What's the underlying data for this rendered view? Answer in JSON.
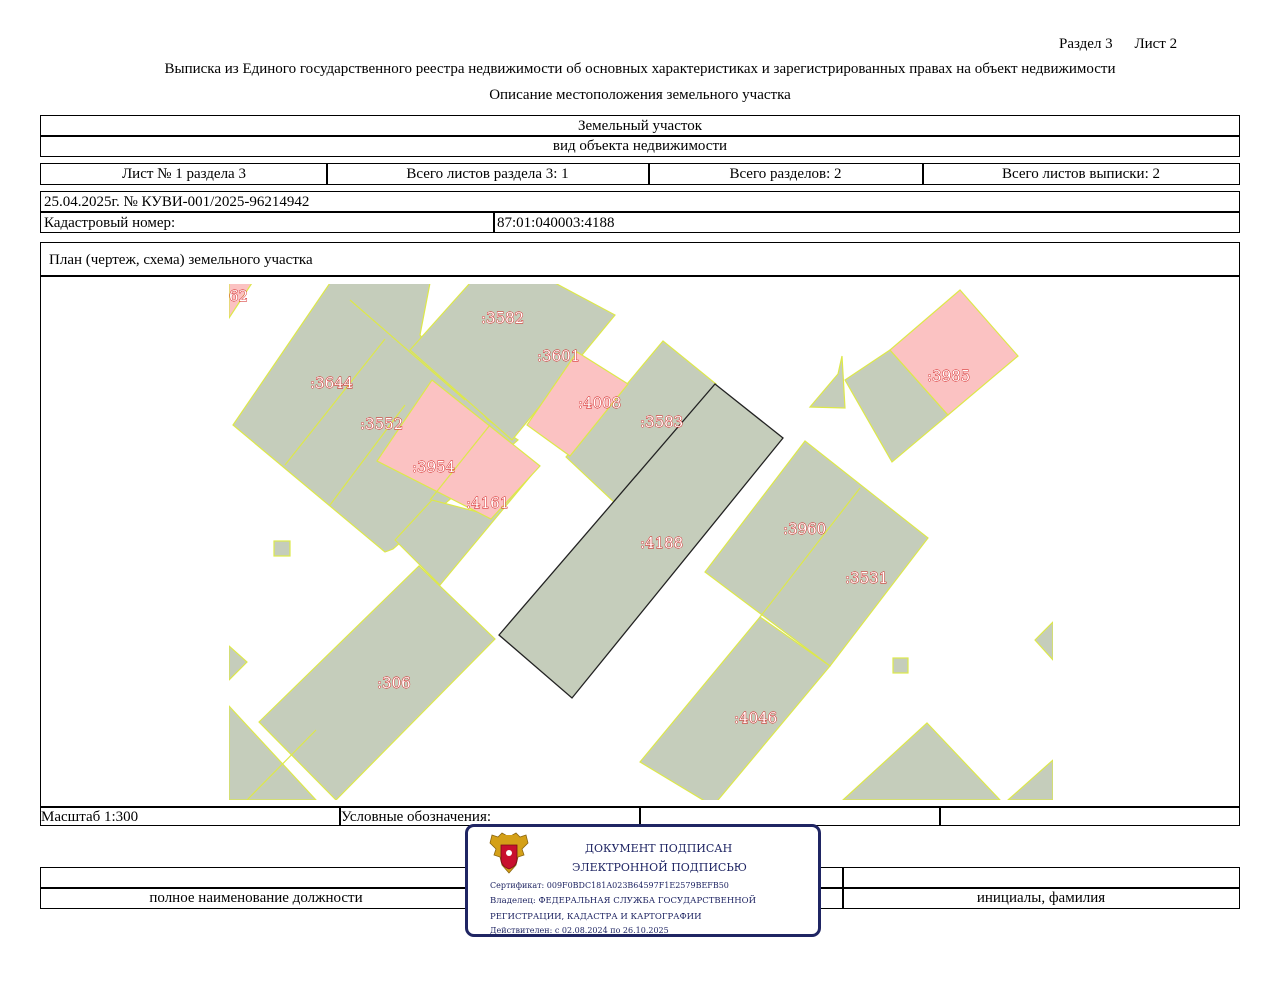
{
  "header": {
    "section": "Раздел 3",
    "sheet": "Лист 2",
    "title": "Выписка из Единого государственного реестра недвижимости об основных характеристиках и зарегистрированных правах на объект недвижимости",
    "subtitle": "Описание местоположения земельного участка"
  },
  "object": {
    "type_value": "Земельный участок",
    "type_caption": "вид объекта недвижимости"
  },
  "sheets": {
    "sheet_no": "Лист № 1 раздела 3",
    "total_section_sheets": "Всего листов раздела 3: 1",
    "total_sections": "Всего разделов: 2",
    "total_extract_sheets": "Всего листов выписки: 2"
  },
  "record": {
    "date_number": "25.04.2025г. № КУВИ-001/2025-96214942",
    "cadastral_label": "Кадастровый номер:",
    "cadastral_value": "87:01:040003:4188"
  },
  "plan": {
    "title": "План (чертеж, схема) земельного участка",
    "labels": {
      "p62": "62",
      "p3582": ":3582",
      "p3601": ":3601",
      "p3644": ":3644",
      "p4008": ":4008",
      "p3583": ":3583",
      "p3552": ":3552",
      "p3954": ":3954",
      "p4161": ":4161",
      "p4188": ":4188",
      "p3960": ":3960",
      "p3531": ":3531",
      "p306": ":306",
      "p4046": ":4046",
      "p3985": ":3985"
    },
    "colors": {
      "parcel_fill": "#c5cdbb",
      "highlight_fill": "#fbc2c2",
      "parcel_stroke": "#dde84a",
      "target_stroke": "#222222",
      "label_outline": "#d11a1a"
    }
  },
  "footer": {
    "scale": "Масштаб 1:300",
    "legend": "Условные обозначения:",
    "position_caption": "полное наименование должности",
    "initials_caption": "инициалы, фамилия"
  },
  "signature": {
    "line1": "ДОКУМЕНТ ПОДПИСАН",
    "line2": "ЭЛЕКТРОННОЙ ПОДПИСЬЮ",
    "certificate": "Сертификат: 009F0BDC181A023B64597F1E2579BEFB50",
    "owner_line1": "Владелец: ФЕДЕРАЛЬНАЯ СЛУЖБА ГОСУДАРСТВЕННОЙ",
    "owner_line2": "РЕГИСТРАЦИИ, КАДАСТРА И КАРТОГРАФИИ",
    "valid": "Действителен: с 02.08.2024 по 26.10.2025",
    "emblem_color": "#c8102e"
  }
}
